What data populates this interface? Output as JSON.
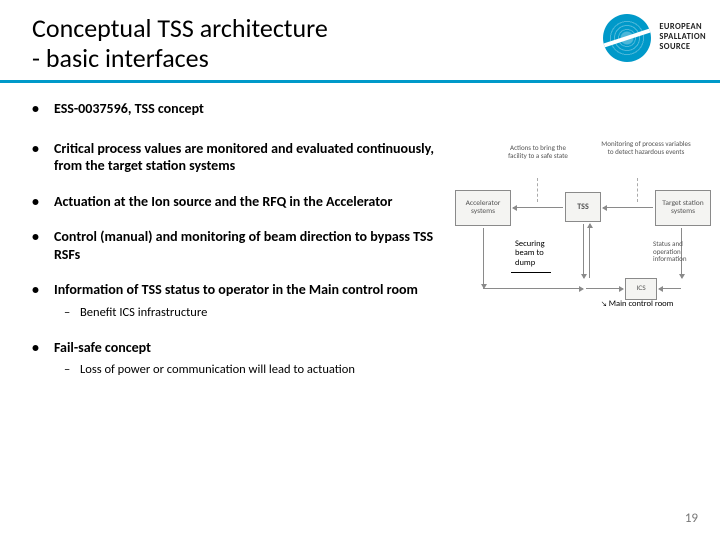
{
  "header": {
    "title_line1": "Conceptual TSS architecture",
    "title_line2": "- basic interfaces",
    "logo_text_l1": "EUROPEAN",
    "logo_text_l2": "SPALLATION",
    "logo_text_l3": "SOURCE"
  },
  "bullets": {
    "b1": "ESS-0037596, TSS concept",
    "b2": "Critical process values are monitored and evaluated continuously, from the target station systems",
    "b3": "Actuation at the Ion source and the RFQ in the Accelerator",
    "b4": "Control (manual) and monitoring of beam direction to bypass TSS RSFs",
    "b5": "Information of TSS status to operator in the Main control room",
    "b5_sub": "Benefit ICS infrastructure",
    "b6": "Fail-safe concept",
    "b6_sub": "Loss of power or communication will lead to actuation"
  },
  "diagram": {
    "accel": "Accelerator systems",
    "tss": "TSS",
    "target": "Target station systems",
    "ics": "ICS",
    "arrow_actions": "Actions to bring the facility to a safe state",
    "arrow_monitor": "Monitoring of process variables to detect hazardous events",
    "arrow_status": "Status and operation information",
    "ann_secure": "Securing beam to dump",
    "ann_mcr": "Main control room"
  },
  "page_number": "19"
}
